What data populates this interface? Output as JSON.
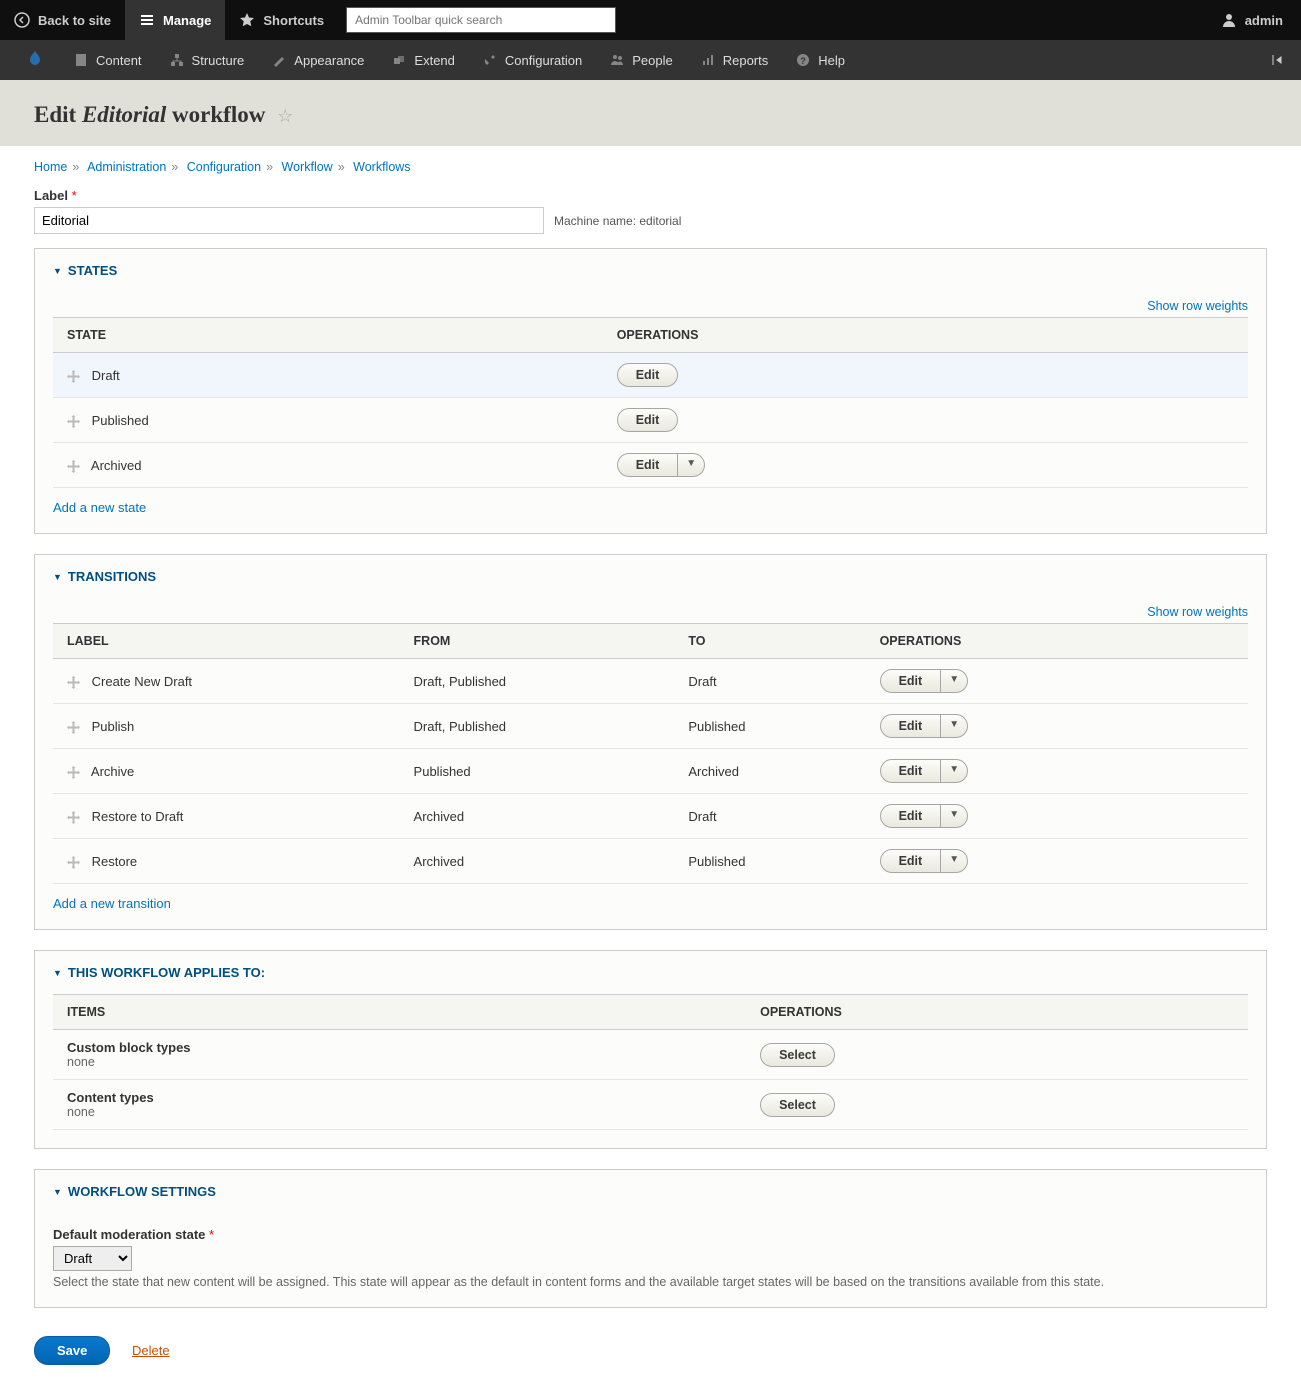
{
  "toolbar": {
    "back": "Back to site",
    "manage": "Manage",
    "shortcuts": "Shortcuts",
    "search_placeholder": "Admin Toolbar quick search",
    "user": "admin"
  },
  "admin_menu": {
    "content": "Content",
    "structure": "Structure",
    "appearance": "Appearance",
    "extend": "Extend",
    "configuration": "Configuration",
    "people": "People",
    "reports": "Reports",
    "help": "Help"
  },
  "title": {
    "prefix": "Edit ",
    "italic": "Editorial",
    "suffix": " workflow"
  },
  "breadcrumb": {
    "home": "Home",
    "administration": "Administration",
    "configuration": "Configuration",
    "workflow": "Workflow",
    "workflows": "Workflows"
  },
  "label_field": {
    "label": "Label",
    "value": "Editorial",
    "machine_label": "Machine name: editorial"
  },
  "states": {
    "heading": "States",
    "show_weights": "Show row weights",
    "cols": {
      "state": "State",
      "ops": "Operations"
    },
    "rows": [
      {
        "name": "Draft",
        "split": false
      },
      {
        "name": "Published",
        "split": false
      },
      {
        "name": "Archived",
        "split": true
      }
    ],
    "edit": "Edit",
    "add": "Add a new state"
  },
  "transitions": {
    "heading": "Transitions",
    "show_weights": "Show row weights",
    "cols": {
      "label": "Label",
      "from": "From",
      "to": "To",
      "ops": "Operations"
    },
    "rows": [
      {
        "label": "Create New Draft",
        "from": "Draft, Published",
        "to": "Draft"
      },
      {
        "label": "Publish",
        "from": "Draft, Published",
        "to": "Published"
      },
      {
        "label": "Archive",
        "from": "Published",
        "to": "Archived"
      },
      {
        "label": "Restore to Draft",
        "from": "Archived",
        "to": "Draft"
      },
      {
        "label": "Restore",
        "from": "Archived",
        "to": "Published"
      }
    ],
    "edit": "Edit",
    "add": "Add a new transition"
  },
  "applies": {
    "heading": "This workflow applies to:",
    "cols": {
      "items": "Items",
      "ops": "Operations"
    },
    "rows": [
      {
        "title": "Custom block types",
        "sub": "none"
      },
      {
        "title": "Content types",
        "sub": "none"
      }
    ],
    "select": "Select"
  },
  "settings": {
    "heading": "Workflow Settings",
    "field_label": "Default moderation state",
    "value": "Draft",
    "desc": "Select the state that new content will be assigned. This state will appear as the default in content forms and the available target states will be based on the transitions available from this state."
  },
  "actions": {
    "save": "Save",
    "delete": "Delete"
  }
}
